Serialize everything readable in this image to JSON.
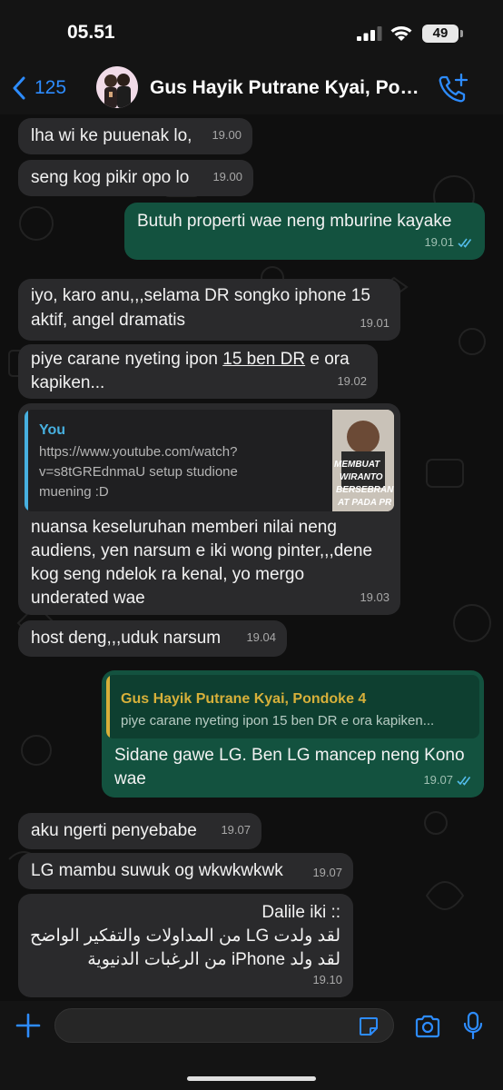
{
  "status_bar": {
    "time": "05.51",
    "battery": "49"
  },
  "header": {
    "back_count": "125",
    "title": "Gus Hayik Putrane Kyai, Pondoke 4"
  },
  "messages": [
    {
      "text": "lha wi ke puuenak lo,",
      "time": "19.00"
    },
    {
      "text": "seng kog pikir opo lo",
      "time": "19.00"
    },
    {
      "text": "Butuh properti wae neng mburine kayake",
      "time": "19.01"
    },
    {
      "line1": "iyo, karo anu,,,selama DR songko iphone 15",
      "line2": "aktif, angel dramatis",
      "time": "19.01"
    },
    {
      "pre": "piye carane nyeting ipon ",
      "underlined": "15 ben DR",
      "post": " e ora",
      "line2": "kapiken...",
      "time": "19.02"
    },
    {
      "quote_author": "You",
      "quote_lines": [
        "https://www.youtube.com/watch?",
        "v=s8tGREdnmaU setup studione",
        "muening :D"
      ],
      "thumbnail_text": [
        "MEMBUAT",
        "WIRANTO",
        "BERSEBRAN",
        "AT PADA PR"
      ],
      "lines": [
        "nuansa keseluruhan memberi nilai neng",
        "audiens, yen narsum e iki wong pinter,,,dene",
        "kog seng ndelok ra kenal, yo mergo",
        "underated wae"
      ],
      "time": "19.03"
    },
    {
      "text": "host deng,,,uduk narsum",
      "time": "19.04"
    },
    {
      "quote_author": "Gus Hayik Putrane Kyai, Pondoke 4",
      "quote_text": "piye carane nyeting ipon 15 ben DR e ora kapiken...",
      "lines": [
        "Sidane gawe LG. Ben LG mancep neng Kono",
        "wae"
      ],
      "time": "19.07"
    },
    {
      "text": "aku ngerti penyebabe",
      "time": "19.07"
    },
    {
      "text": "LG mambu suwuk og wkwkwkwk",
      "time": "19.07"
    },
    {
      "lines": [
        "Dalile iki ::",
        "لقد ولدت LG من المداولات والتفكير الواضح",
        "لقد ولد iPhone من الرغبات الدنيوية"
      ],
      "time": "19.10"
    }
  ],
  "icons": {
    "back": "chevron-left-icon",
    "call": "phone-plus-icon",
    "plus": "plus-icon",
    "sticker": "sticker-icon",
    "camera": "camera-icon",
    "mic": "microphone-icon"
  },
  "colors": {
    "accent": "#2d8cff",
    "incoming_bubble": "#2a2a2c",
    "outgoing_bubble": "#13523f",
    "read_ticks": "#53bdeb",
    "quote_you": "#47b0e0",
    "quote_other": "#d7b03a"
  }
}
